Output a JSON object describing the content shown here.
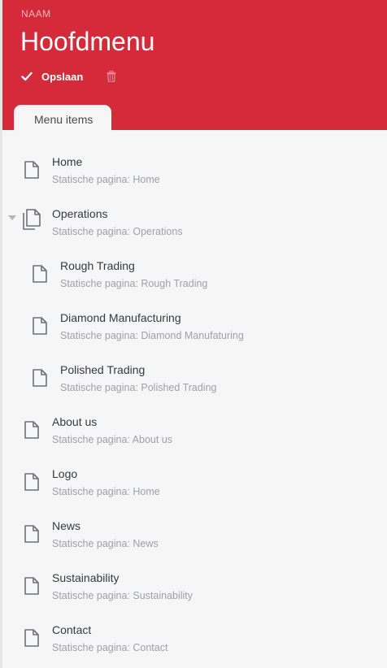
{
  "header": {
    "name_label": "NAAM",
    "title": "Hoofdmenu",
    "save_label": "Opslaan",
    "save_icon": "check-icon",
    "delete_icon": "trash-icon",
    "background_color": "#d42a3a"
  },
  "tabs": [
    {
      "label": "Menu items",
      "active": true
    }
  ],
  "menu_items": [
    {
      "title": "Home",
      "subtitle": "Statische pagina: Home",
      "level": 0,
      "icon": "page-icon"
    },
    {
      "title": "Operations",
      "subtitle": "Statische pagina: Operations",
      "level": 0,
      "icon": "pages-icon",
      "expanded": true
    },
    {
      "title": "Rough Trading",
      "subtitle": "Statische pagina: Rough Trading",
      "level": 1,
      "icon": "page-icon"
    },
    {
      "title": "Diamond Manufacturing",
      "subtitle": "Statische pagina: Diamond Manufaturing",
      "level": 1,
      "icon": "page-icon"
    },
    {
      "title": "Polished Trading",
      "subtitle": "Statische pagina: Polished Trading",
      "level": 1,
      "icon": "page-icon"
    },
    {
      "title": "About us",
      "subtitle": "Statische pagina: About us",
      "level": 0,
      "icon": "page-icon"
    },
    {
      "title": "Logo",
      "subtitle": "Statische pagina: Home",
      "level": 0,
      "icon": "page-icon"
    },
    {
      "title": "News",
      "subtitle": "Statische pagina: News",
      "level": 0,
      "icon": "page-icon"
    },
    {
      "title": "Sustainability",
      "subtitle": "Statische pagina: Sustainability",
      "level": 0,
      "icon": "page-icon"
    },
    {
      "title": "Contact",
      "subtitle": "Statische pagina: Contact",
      "level": 0,
      "icon": "page-icon"
    }
  ]
}
